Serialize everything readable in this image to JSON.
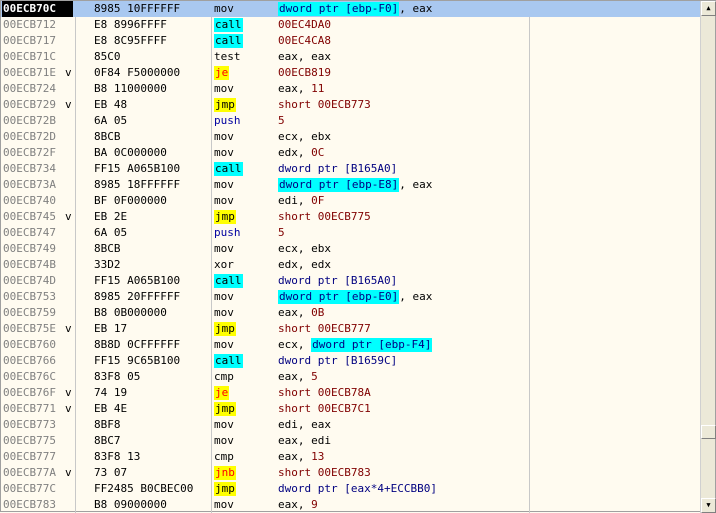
{
  "disassembly": {
    "rows": [
      {
        "addr": "00ECB70C",
        "marker": "",
        "hex": "8985 10FFFFFF",
        "mnem": "mov",
        "mnem_class": "",
        "op_parts": [
          {
            "t": "dword ptr [ebp-F0]",
            "c": "op-mem"
          },
          {
            "t": ", eax",
            "c": "op-plain"
          }
        ]
      },
      {
        "addr": "00ECB712",
        "marker": "",
        "hex": "E8 8996FFFF",
        "mnem": "call",
        "mnem_class": "m-call",
        "op_parts": [
          {
            "t": "00EC4DA0",
            "c": "op-addr"
          }
        ]
      },
      {
        "addr": "00ECB717",
        "marker": "",
        "hex": "E8 8C95FFFF",
        "mnem": "call",
        "mnem_class": "m-call",
        "op_parts": [
          {
            "t": "00EC4CA8",
            "c": "op-addr"
          }
        ]
      },
      {
        "addr": "00ECB71C",
        "marker": "",
        "hex": "85C0",
        "mnem": "test",
        "mnem_class": "",
        "op_parts": [
          {
            "t": "eax, eax",
            "c": "op-plain"
          }
        ]
      },
      {
        "addr": "00ECB71E",
        "marker": "v",
        "hex": "0F84 F5000000",
        "mnem": "je",
        "mnem_class": "m-jcc",
        "op_parts": [
          {
            "t": "00ECB819",
            "c": "op-addr"
          }
        ]
      },
      {
        "addr": "00ECB724",
        "marker": "",
        "hex": "B8 11000000",
        "mnem": "mov",
        "mnem_class": "",
        "op_parts": [
          {
            "t": "eax, ",
            "c": "op-plain"
          },
          {
            "t": "11",
            "c": "op-num"
          }
        ]
      },
      {
        "addr": "00ECB729",
        "marker": "v",
        "hex": "EB 48",
        "mnem": "jmp",
        "mnem_class": "m-jmp",
        "op_parts": [
          {
            "t": "short 00ECB773",
            "c": "op-addr"
          }
        ]
      },
      {
        "addr": "00ECB72B",
        "marker": "",
        "hex": "6A 05",
        "mnem": "push",
        "mnem_class": "m-push",
        "op_parts": [
          {
            "t": "5",
            "c": "op-num"
          }
        ]
      },
      {
        "addr": "00ECB72D",
        "marker": "",
        "hex": "8BCB",
        "mnem": "mov",
        "mnem_class": "",
        "op_parts": [
          {
            "t": "ecx, ebx",
            "c": "op-plain"
          }
        ]
      },
      {
        "addr": "00ECB72F",
        "marker": "",
        "hex": "BA 0C000000",
        "mnem": "mov",
        "mnem_class": "",
        "op_parts": [
          {
            "t": "edx, ",
            "c": "op-plain"
          },
          {
            "t": "0C",
            "c": "op-num"
          }
        ]
      },
      {
        "addr": "00ECB734",
        "marker": "",
        "hex": "FF15 A065B100",
        "mnem": "call",
        "mnem_class": "m-call",
        "op_parts": [
          {
            "t": "dword ptr [B165A0]",
            "c": "op-code"
          }
        ]
      },
      {
        "addr": "00ECB73A",
        "marker": "",
        "hex": "8985 18FFFFFF",
        "mnem": "mov",
        "mnem_class": "",
        "op_parts": [
          {
            "t": "dword ptr [ebp-E8]",
            "c": "op-mem"
          },
          {
            "t": ", eax",
            "c": "op-plain"
          }
        ]
      },
      {
        "addr": "00ECB740",
        "marker": "",
        "hex": "BF 0F000000",
        "mnem": "mov",
        "mnem_class": "",
        "op_parts": [
          {
            "t": "edi, ",
            "c": "op-plain"
          },
          {
            "t": "0F",
            "c": "op-num"
          }
        ]
      },
      {
        "addr": "00ECB745",
        "marker": "v",
        "hex": "EB 2E",
        "mnem": "jmp",
        "mnem_class": "m-jmp",
        "op_parts": [
          {
            "t": "short 00ECB775",
            "c": "op-addr"
          }
        ]
      },
      {
        "addr": "00ECB747",
        "marker": "",
        "hex": "6A 05",
        "mnem": "push",
        "mnem_class": "m-push",
        "op_parts": [
          {
            "t": "5",
            "c": "op-num"
          }
        ]
      },
      {
        "addr": "00ECB749",
        "marker": "",
        "hex": "8BCB",
        "mnem": "mov",
        "mnem_class": "",
        "op_parts": [
          {
            "t": "ecx, ebx",
            "c": "op-plain"
          }
        ]
      },
      {
        "addr": "00ECB74B",
        "marker": "",
        "hex": "33D2",
        "mnem": "xor",
        "mnem_class": "",
        "op_parts": [
          {
            "t": "edx, edx",
            "c": "op-plain"
          }
        ]
      },
      {
        "addr": "00ECB74D",
        "marker": "",
        "hex": "FF15 A065B100",
        "mnem": "call",
        "mnem_class": "m-call",
        "op_parts": [
          {
            "t": "dword ptr [B165A0]",
            "c": "op-code"
          }
        ]
      },
      {
        "addr": "00ECB753",
        "marker": "",
        "hex": "8985 20FFFFFF",
        "mnem": "mov",
        "mnem_class": "",
        "op_parts": [
          {
            "t": "dword ptr [ebp-E0]",
            "c": "op-mem"
          },
          {
            "t": ", eax",
            "c": "op-plain"
          }
        ]
      },
      {
        "addr": "00ECB759",
        "marker": "",
        "hex": "B8 0B000000",
        "mnem": "mov",
        "mnem_class": "",
        "op_parts": [
          {
            "t": "eax, ",
            "c": "op-plain"
          },
          {
            "t": "0B",
            "c": "op-num"
          }
        ]
      },
      {
        "addr": "00ECB75E",
        "marker": "v",
        "hex": "EB 17",
        "mnem": "jmp",
        "mnem_class": "m-jmp",
        "op_parts": [
          {
            "t": "short 00ECB777",
            "c": "op-addr"
          }
        ]
      },
      {
        "addr": "00ECB760",
        "marker": "",
        "hex": "8B8D 0CFFFFFF",
        "mnem": "mov",
        "mnem_class": "",
        "op_parts": [
          {
            "t": "ecx, ",
            "c": "op-plain"
          },
          {
            "t": "dword ptr [ebp-F4]",
            "c": "op-mem"
          }
        ]
      },
      {
        "addr": "00ECB766",
        "marker": "",
        "hex": "FF15 9C65B100",
        "mnem": "call",
        "mnem_class": "m-call",
        "op_parts": [
          {
            "t": "dword ptr [B1659C]",
            "c": "op-code"
          }
        ]
      },
      {
        "addr": "00ECB76C",
        "marker": "",
        "hex": "83F8 05",
        "mnem": "cmp",
        "mnem_class": "",
        "op_parts": [
          {
            "t": "eax, ",
            "c": "op-plain"
          },
          {
            "t": "5",
            "c": "op-num"
          }
        ]
      },
      {
        "addr": "00ECB76F",
        "marker": "v",
        "hex": "74 19",
        "mnem": "je",
        "mnem_class": "m-jcc",
        "op_parts": [
          {
            "t": "short 00ECB78A",
            "c": "op-addr"
          }
        ]
      },
      {
        "addr": "00ECB771",
        "marker": "v",
        "hex": "EB 4E",
        "mnem": "jmp",
        "mnem_class": "m-jmp",
        "op_parts": [
          {
            "t": "short 00ECB7C1",
            "c": "op-addr"
          }
        ]
      },
      {
        "addr": "00ECB773",
        "marker": "",
        "hex": "8BF8",
        "mnem": "mov",
        "mnem_class": "",
        "op_parts": [
          {
            "t": "edi, eax",
            "c": "op-plain"
          }
        ]
      },
      {
        "addr": "00ECB775",
        "marker": "",
        "hex": "8BC7",
        "mnem": "mov",
        "mnem_class": "",
        "op_parts": [
          {
            "t": "eax, edi",
            "c": "op-plain"
          }
        ]
      },
      {
        "addr": "00ECB777",
        "marker": "",
        "hex": "83F8 13",
        "mnem": "cmp",
        "mnem_class": "",
        "op_parts": [
          {
            "t": "eax, ",
            "c": "op-plain"
          },
          {
            "t": "13",
            "c": "op-num"
          }
        ]
      },
      {
        "addr": "00ECB77A",
        "marker": "v",
        "hex": "73 07",
        "mnem": "jnb",
        "mnem_class": "m-jcc",
        "op_parts": [
          {
            "t": "short 00ECB783",
            "c": "op-addr"
          }
        ]
      },
      {
        "addr": "00ECB77C",
        "marker": "",
        "hex": "FF2485 B0CBEC00",
        "mnem": "jmp",
        "mnem_class": "m-jmp",
        "op_parts": [
          {
            "t": "dword ptr [eax*4+ECCBB0]",
            "c": "op-code"
          }
        ]
      },
      {
        "addr": "00ECB783",
        "marker": "",
        "hex": "B8 09000000",
        "mnem": "mov",
        "mnem_class": "",
        "op_parts": [
          {
            "t": "eax, ",
            "c": "op-plain"
          },
          {
            "t": "9",
            "c": "op-num"
          }
        ]
      }
    ]
  },
  "scrollbar": {
    "up_icon": "arrow-up-icon",
    "down_icon": "arrow-down-icon",
    "up_glyph": "▲",
    "down_glyph": "▼"
  },
  "colors": {
    "background": "#fffbf0",
    "selection": "#a9c8f0",
    "call_highlight": "#00ffff",
    "jump_highlight": "#ffff00",
    "conditional_jump_text": "#ff0000"
  }
}
